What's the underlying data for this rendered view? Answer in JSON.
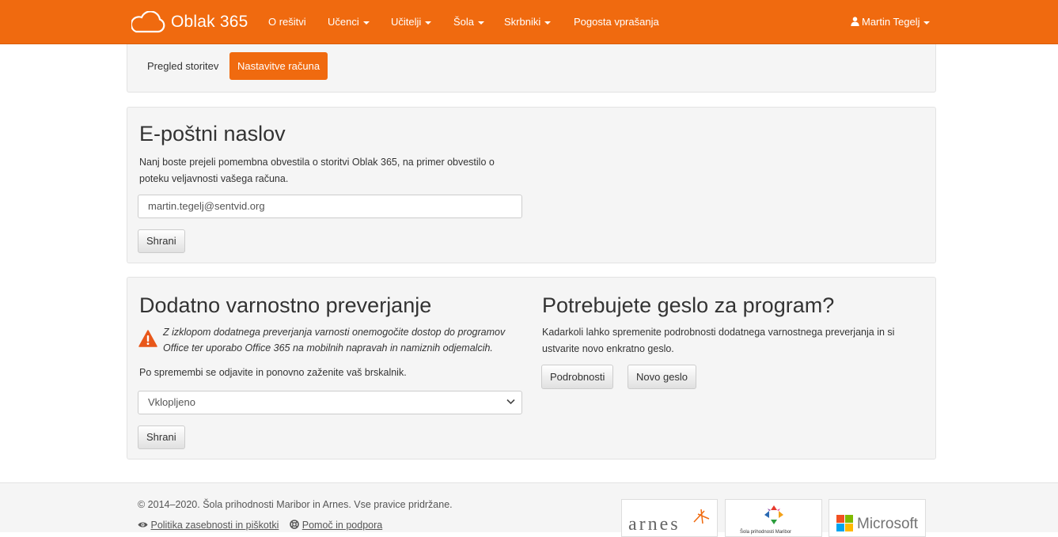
{
  "navbar": {
    "brand": "Oblak 365",
    "items": [
      {
        "label": "O rešitvi",
        "dropdown": false
      },
      {
        "label": "Učenci",
        "dropdown": true
      },
      {
        "label": "Učitelji",
        "dropdown": true
      },
      {
        "label": "Šola",
        "dropdown": true
      },
      {
        "label": "Skrbniki",
        "dropdown": true
      },
      {
        "label": "Pogosta vprašanja",
        "dropdown": false
      }
    ],
    "user": "Martin Tegelj",
    "color": "#f06a0f"
  },
  "subnav": {
    "tabs": [
      {
        "label": "Pregled storitev",
        "active": false
      },
      {
        "label": "Nastavitve računa",
        "active": true
      }
    ]
  },
  "email_section": {
    "title": "E-poštni naslov",
    "description": "Nanj boste prejeli pomembna obvestila o storitvi Oblak 365, na primer obvestilo o poteku veljavnosti vašega računa.",
    "email_value": "martin.tegelj@sentvid.org",
    "save_label": "Shrani"
  },
  "security_section": {
    "title": "Dodatno varnostno preverjanje",
    "warning": "Z izklopom dodatnega preverjanja varnosti onemogočite dostop do programov Office ter uporabo Office 365 na mobilnih napravah in namiznih odjemalcih.",
    "note": "Po spremembi se odjavite in ponovno zaženite vaš brskalnik.",
    "selected_option": "Vklopljeno",
    "save_label": "Shrani",
    "warning_color": "#e8571a"
  },
  "password_section": {
    "title": "Potrebujete geslo za program?",
    "description": "Kadarkoli lahko spremenite podrobnosti dodatnega varnostnega preverjanja in si ustvarite novo enkratno geslo.",
    "details_label": "Podrobnosti",
    "new_password_label": "Novo geslo"
  },
  "footer": {
    "copyright": "© 2014–2020. Šola prihodnosti Maribor in Arnes. Vse pravice pridržane.",
    "privacy_link": "Politika zasebnosti in piškotki",
    "help_link": "Pomoč in podpora",
    "logos": {
      "arnes": "arnes",
      "sola": "Šola prihodnosti Maribor",
      "microsoft": "Microsoft"
    }
  }
}
